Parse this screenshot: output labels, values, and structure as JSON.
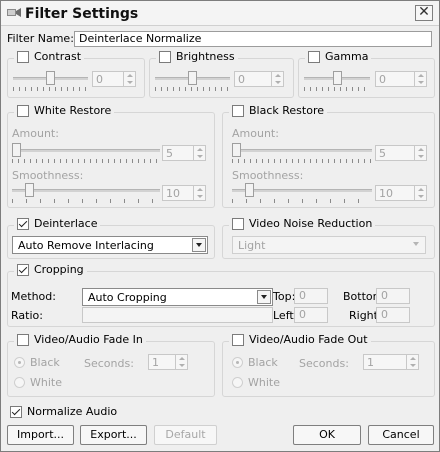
{
  "window": {
    "title": "Filter Settings",
    "title_icon": "filter-app-icon",
    "close_icon": "close-icon"
  },
  "filter_name": {
    "label": "Filter Name:",
    "value": "Deinterlace Normalize"
  },
  "contrast": {
    "label": "Contrast",
    "checked": false,
    "value": "0",
    "level": 0.5
  },
  "brightness": {
    "label": "Brightness",
    "checked": false,
    "value": "0",
    "level": 0.5
  },
  "gamma": {
    "label": "Gamma",
    "checked": false,
    "value": "0",
    "level": 0.5
  },
  "white_restore": {
    "label": "White Restore",
    "checked": false,
    "amount_label": "Amount:",
    "amount_value": "5",
    "smoothness_label": "Smoothness:",
    "smoothness_value": "10"
  },
  "black_restore": {
    "label": "Black Restore",
    "checked": false,
    "amount_label": "Amount:",
    "amount_value": "5",
    "smoothness_label": "Smoothness:",
    "smoothness_value": "10"
  },
  "deinterlace": {
    "label": "Deinterlace",
    "checked": true,
    "mode": "Auto Remove Interlacing"
  },
  "video_noise_reduction": {
    "label": "Video Noise Reduction",
    "checked": false,
    "level": "Light"
  },
  "cropping": {
    "label": "Cropping",
    "checked": true,
    "method_label": "Method:",
    "method": "Auto Cropping",
    "ratio_label": "Ratio:",
    "top_label": "Top:",
    "top": "0",
    "bottom_label": "Bottom:",
    "bottom": "0",
    "left_label": "Left:",
    "left": "0",
    "right_label": "Right:",
    "right": "0"
  },
  "fade_in": {
    "label": "Video/Audio Fade In",
    "checked": false,
    "black_label": "Black",
    "white_label": "White",
    "seconds_label": "Seconds:",
    "seconds": "1"
  },
  "fade_out": {
    "label": "Video/Audio Fade Out",
    "checked": false,
    "black_label": "Black",
    "white_label": "White",
    "seconds_label": "Seconds:",
    "seconds": "1"
  },
  "normalize_audio": {
    "label": "Normalize Audio",
    "checked": true
  },
  "buttons": {
    "import": "Import...",
    "export": "Export...",
    "default": "Default",
    "ok": "OK",
    "cancel": "Cancel"
  },
  "colors": {
    "dialog_bg": "#efefef",
    "disabled_text": "#a3a3a3",
    "group_border": "#d6d6d6"
  }
}
